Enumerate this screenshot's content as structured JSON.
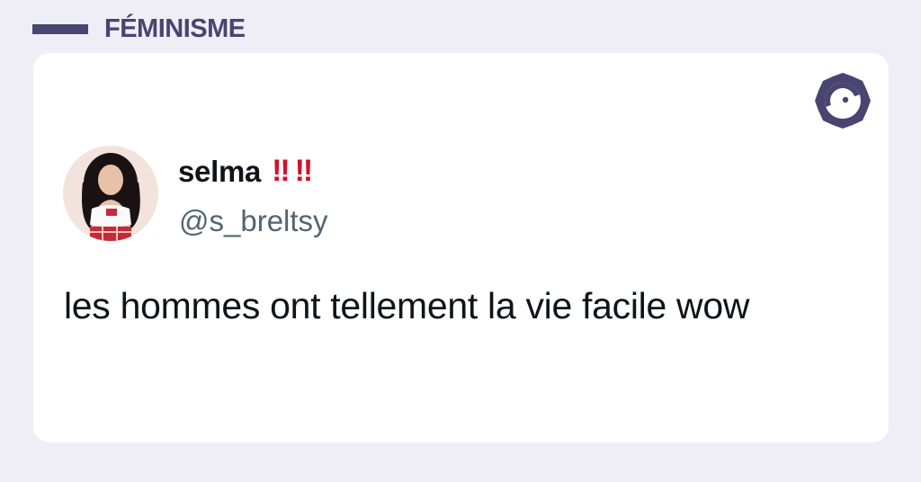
{
  "header": {
    "category": "FÉMINISME"
  },
  "tweet": {
    "display_name": "selma",
    "name_emojis": [
      "‼",
      "‼"
    ],
    "handle": "@s_breltsy",
    "text": "les hommes ont tellement la vie facile wow"
  },
  "icons": {
    "brand": "brand-logo-icon",
    "avatar": "profile-avatar"
  },
  "colors": {
    "background": "#EFEEF7",
    "accent": "#4A4470",
    "card": "#FFFFFF",
    "emoji_red": "#D0112B",
    "handle_gray": "#536471"
  }
}
